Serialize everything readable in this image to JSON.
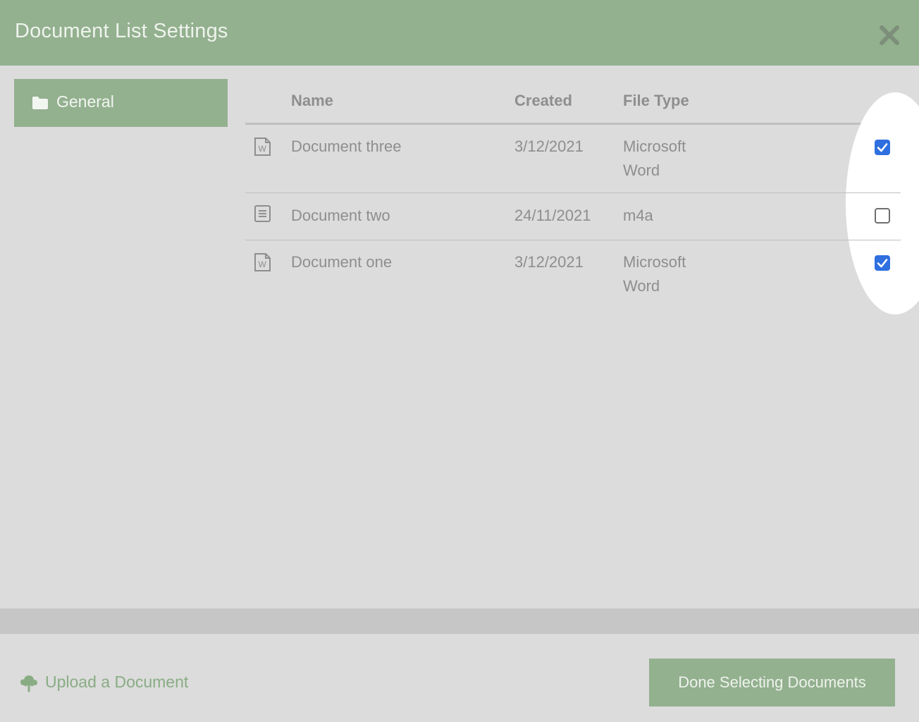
{
  "dialog": {
    "title": "Document List Settings",
    "close_icon": "close-icon"
  },
  "sidebar": {
    "items": [
      {
        "label": "General",
        "icon": "folder-icon",
        "selected": true
      }
    ]
  },
  "table": {
    "headers": {
      "name": "Name",
      "created": "Created",
      "file_type": "File Type"
    },
    "rows": [
      {
        "icon": "word-document-icon",
        "name": "Document three",
        "created": "3/12/2021",
        "file_type_line1": "Microsoft",
        "file_type_line2": "Word",
        "checked": true
      },
      {
        "icon": "text-document-icon",
        "name": "Document two",
        "created": "24/11/2021",
        "file_type_line1": "m4a",
        "file_type_line2": "",
        "checked": false
      },
      {
        "icon": "word-document-icon",
        "name": "Document one",
        "created": "3/12/2021",
        "file_type_line1": "Microsoft",
        "file_type_line2": "Word",
        "checked": true
      }
    ]
  },
  "footer": {
    "upload_label": "Upload a Document",
    "upload_icon": "cloud-upload-icon",
    "done_label": "Done Selecting Documents"
  },
  "colors": {
    "accent_green": "#93b08f",
    "checkbox_blue": "#2f6fe0",
    "background": "#dcdcdc"
  }
}
